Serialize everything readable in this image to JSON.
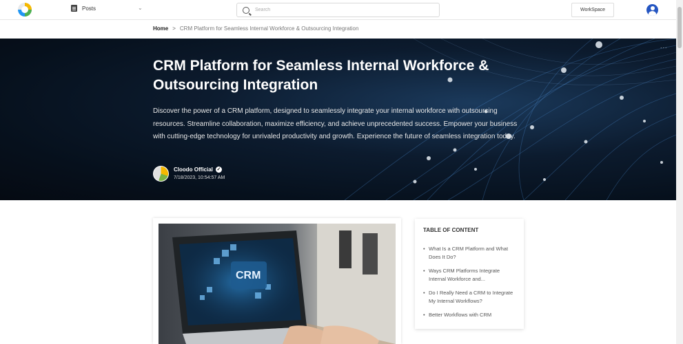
{
  "header": {
    "nav_label": "Posts",
    "search_placeholder": "Search",
    "workspace_label": "WorkSpace"
  },
  "breadcrumb": {
    "home": "Home",
    "separator": ">",
    "current": "CRM Platform for Seamless Internal Workforce & Outsourcing Integration"
  },
  "hero": {
    "menu": "...",
    "title": "CRM Platform for Seamless Internal Workforce & Outsourcing Integration",
    "description": "Discover the power of a CRM platform, designed to seamlessly integrate your internal workforce with outsourcing resources. Streamline collaboration, maximize efficiency, and achieve unprecedented success. Empower your business with cutting-edge technology for unrivaled productivity and growth. Experience the future of seamless integration today.",
    "author": "Cloodo Official",
    "verified_glyph": "✓",
    "date": "7/18/2023, 10:54:57 AM"
  },
  "article": {
    "image_text": "CRM"
  },
  "toc": {
    "title": "TABLE OF CONTENT",
    "items": [
      "What Is a CRM Platform and What Does It Do?",
      "Ways CRM Platforms Integrate Internal Workforce and...",
      "Do I Really Need a CRM to Integrate My Internal Workflows?",
      "Better Workflows with CRM"
    ]
  },
  "colors": {
    "accent": "#2556c2",
    "hero_bg": "#06101c"
  }
}
